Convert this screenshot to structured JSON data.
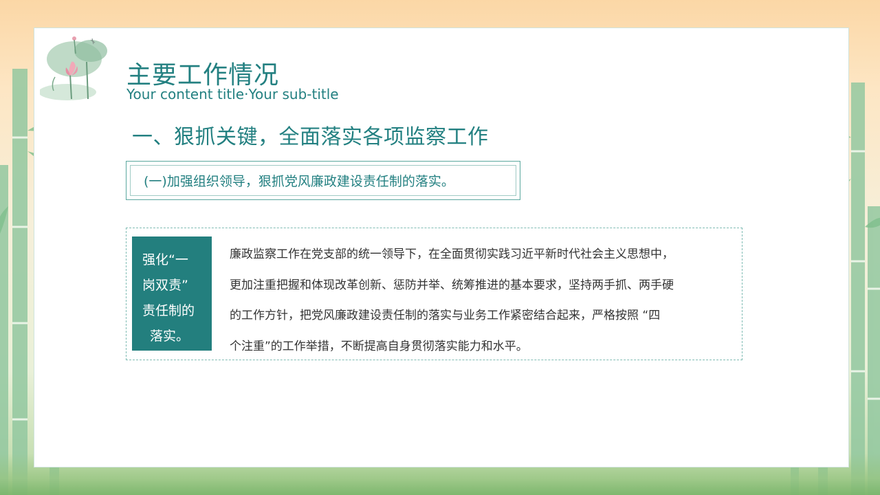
{
  "slide": {
    "title": "主要工作情况",
    "subtitle": "Your content title·Your sub-title",
    "section_heading": "一、狠抓关键，全面落实各项监察工作",
    "point": "(一)加强组织领导，狠抓党风廉政建设责任制的落实。",
    "tag_lines": [
      "强化“一",
      "岗双责”",
      "责任制的",
      "落实。"
    ],
    "body_lines": [
      "廉政监察工作在党支部的统一领导下，在全面贯彻实践习近平新时代社会主义思想中，",
      "更加注重把握和体现改革创新、惩防并举、统筹推进的基本要求，坚持两手抓、两手硬",
      "的工作方针，把党风廉政建设责任制的落实与业务工作紧密结合起来，严格按照 “四",
      "个注重”的工作举措，不断提高自身贯彻落实能力和水平。"
    ]
  },
  "colors": {
    "accent": "#238081",
    "tag_background": "#237f7e",
    "body_text": "#333333",
    "background_top": "#fbd7a6",
    "bamboo": "#8cc69a"
  },
  "decorations": {
    "corner_image": "lotus-painting",
    "side_image": "bamboo-stalks"
  }
}
